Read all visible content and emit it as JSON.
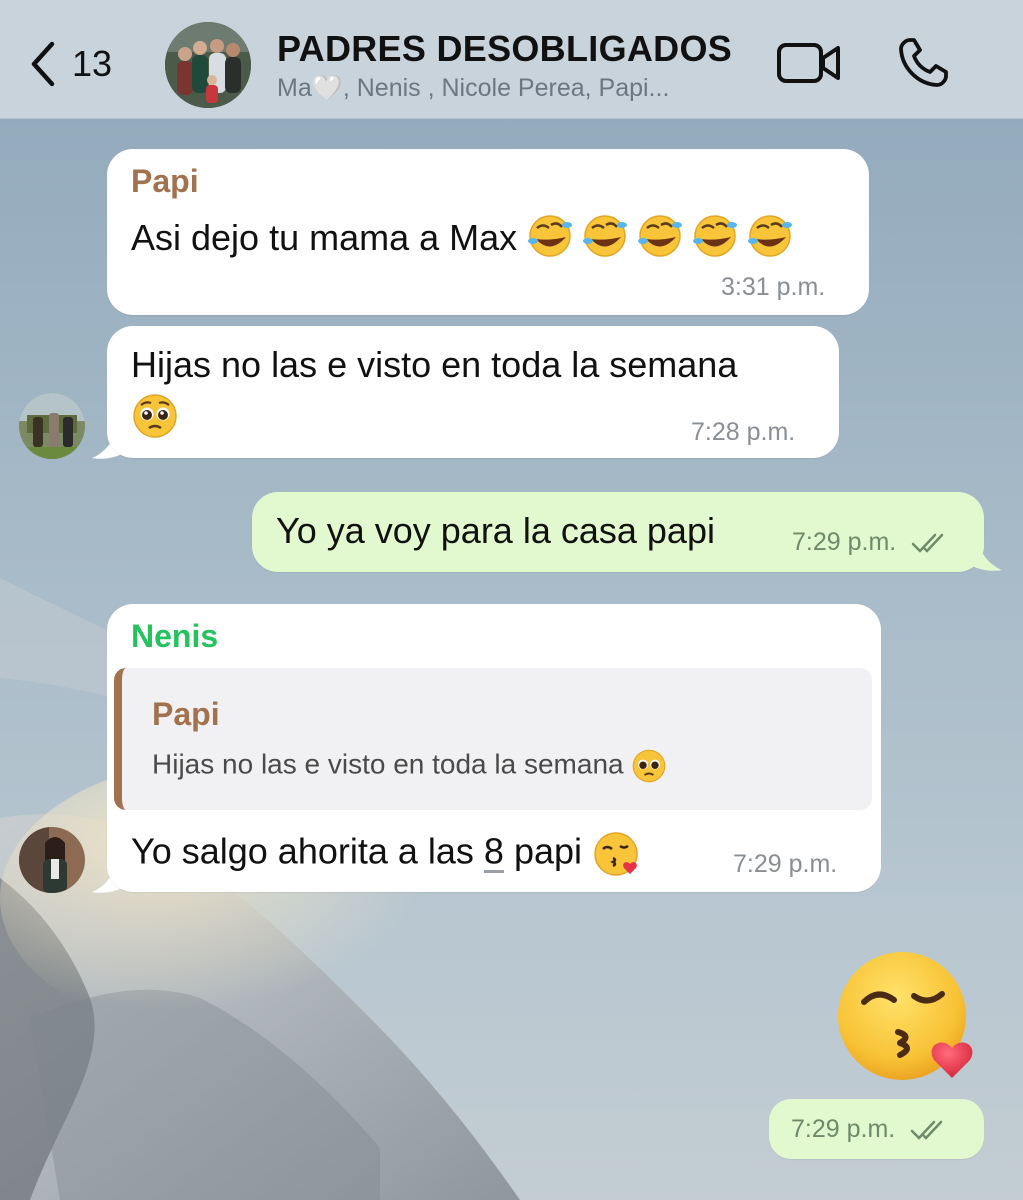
{
  "header": {
    "back_count": "13",
    "title": "PADRES DESOBLIGADOS",
    "subtitle": "Ma🤍, Nenis , Nicole Perea, Papi..."
  },
  "messages": [
    {
      "sender": "Papi",
      "sender_color": "#a1724d",
      "text": "Asi dejo tu mama a Max",
      "emoji": "rofl-emoji x5",
      "time": "3:31 p.m."
    },
    {
      "text": "Hijas no las e visto en toda la semana",
      "emoji": "pleading-face-emoji",
      "time": "7:28 p.m."
    },
    {
      "text": "Yo ya voy para la casa papi",
      "time": "7:29 p.m.",
      "status": "read"
    },
    {
      "sender": "Nenis",
      "sender_color": "#25c25e",
      "quote": {
        "sender": "Papi",
        "text": "Hijas no las e visto en toda la semana"
      },
      "text_before": "Yo salgo ahorita a las ",
      "text_number": "8",
      "text_after": " papi",
      "emoji": "kissing-heart-emoji",
      "time": "7:29 p.m."
    },
    {
      "emoji": "kissing-heart-emoji",
      "time": "7:29 p.m.",
      "status": "read"
    }
  ]
}
